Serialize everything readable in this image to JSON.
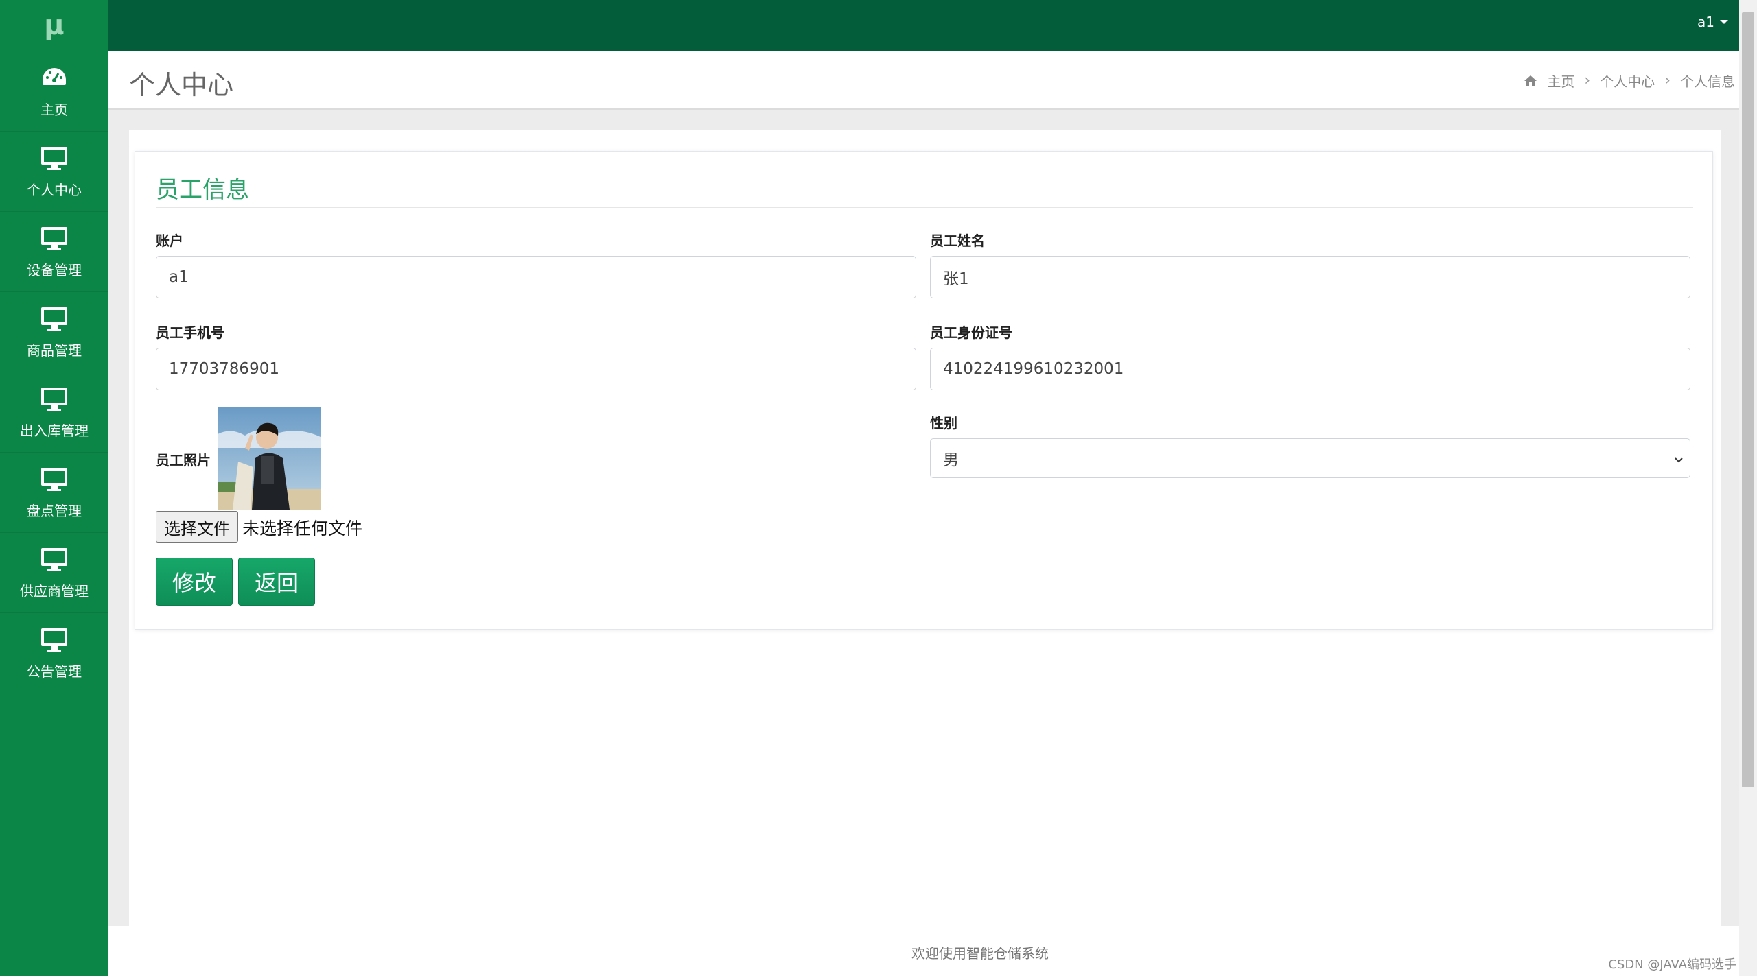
{
  "logo": {
    "text": "μ"
  },
  "sidebar": {
    "items": [
      {
        "label": "主页",
        "icon": "dashboard-icon"
      },
      {
        "label": "个人中心",
        "icon": "monitor-icon"
      },
      {
        "label": "设备管理",
        "icon": "monitor-icon"
      },
      {
        "label": "商品管理",
        "icon": "monitor-icon"
      },
      {
        "label": "出入库管理",
        "icon": "monitor-icon"
      },
      {
        "label": "盘点管理",
        "icon": "monitor-icon"
      },
      {
        "label": "供应商管理",
        "icon": "monitor-icon"
      },
      {
        "label": "公告管理",
        "icon": "monitor-icon"
      }
    ]
  },
  "topbar": {
    "user": "a1"
  },
  "header": {
    "title": "个人中心",
    "breadcrumb": [
      "主页",
      "个人中心",
      "个人信息"
    ]
  },
  "form": {
    "title": "员工信息",
    "account_label": "账户",
    "account_value": "a1",
    "name_label": "员工姓名",
    "name_value": "张1",
    "phone_label": "员工手机号",
    "phone_value": "17703786901",
    "idcard_label": "员工身份证号",
    "idcard_value": "410224199610232001",
    "photo_label": "员工照片",
    "file_button": "选择文件",
    "file_status": "未选择任何文件",
    "gender_label": "性别",
    "gender_value": "男",
    "modify_button": "修改",
    "back_button": "返回"
  },
  "footer": {
    "text": "欢迎使用智能仓储系统"
  },
  "watermark": "CSDN @JAVA编码选手",
  "colors": {
    "sidebar": "#0b8646",
    "topbar": "#035d3b",
    "accent": "#2aa36a",
    "button": "#17a769"
  }
}
